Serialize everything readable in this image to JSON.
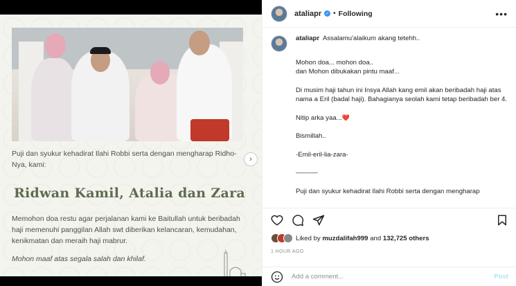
{
  "post_image": {
    "intro_text": "Puji dan syukur kehadirat Ilahi Robbi serta dengan mengharap Ridho-Nya, kami:",
    "names": "Ridwan Kamil, Atalia dan Zara",
    "body_text": "Memohon doa restu agar perjalanan kami ke Baitullah untuk beribadah haji memenuhi panggilan Allah swt diberikan kelancaran, kemudahan, kenikmatan dan meraih haji mabrur.",
    "closing_text": "Mohon maaf atas segala salah dan khilaf."
  },
  "header": {
    "username": "ataliapr",
    "separator": "•",
    "follow_label": "Following",
    "more_label": "•••"
  },
  "caption": {
    "username": "ataliapr",
    "lines": [
      "Assalamu'alaikum akang tetehh..",
      "Mohon doa... mohon doa..",
      "dan Mohon dibukakan pintu maaf...",
      "Di musim haji tahun ini Insya Allah kang emil akan beribadah haji atas nama a Eril (badal haji). Bahagianya seolah kami tetap beribadah ber 4.",
      "Nitip arka yaa...",
      "Bismillah..",
      "-Emil-eril-lia-zara-",
      "———-",
      "Puji dan syukur kehadirat Ilahi Robbi serta dengan mengharap"
    ],
    "heart": "❤️"
  },
  "likes": {
    "prefix": "Liked by",
    "user": "muzdalifah999",
    "middle": "and",
    "count": "132,725 others"
  },
  "timestamp": "1 HOUR AGO",
  "comment": {
    "placeholder": "Add a comment...",
    "post_label": "Post"
  },
  "colors": {
    "verified": "#3897f0",
    "post_disabled": "#b2dffc",
    "names_green": "#5f6b4f"
  }
}
